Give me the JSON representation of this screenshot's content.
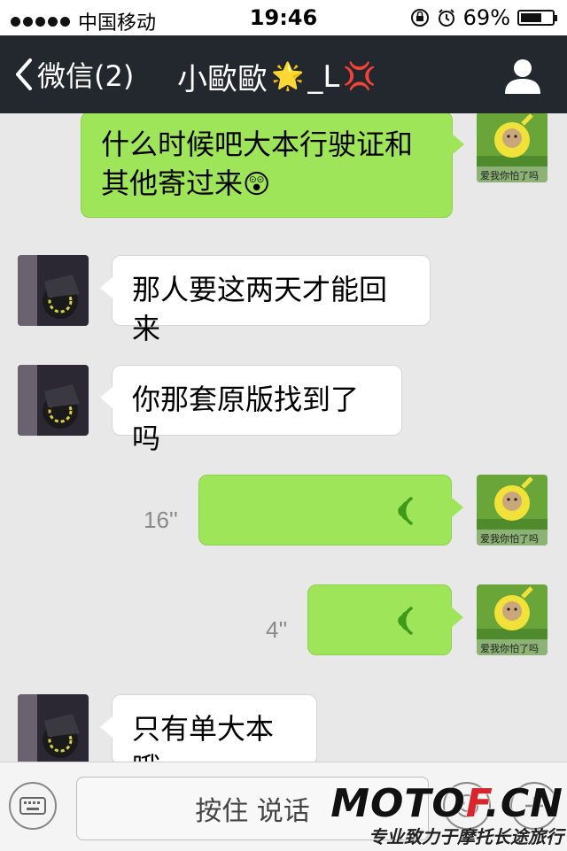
{
  "status_bar": {
    "carrier": "中国移动",
    "time": "19:46",
    "battery_text": "69%",
    "battery_level": 0.69,
    "icons": [
      "signal-dots",
      "lock-rotation-icon",
      "alarm-icon",
      "battery-icon"
    ]
  },
  "nav": {
    "back_label": "微信(2)",
    "title_prefix": "小歐歐",
    "title_suffix": "_L",
    "title_emoji_1": "🌟",
    "title_emoji_2": "💢",
    "profile_icon": "person-icon"
  },
  "messages": [
    {
      "from": "self",
      "type": "text",
      "text_line1": "什么时候吧大本行驶证和",
      "text_line2": "其他寄过来",
      "emoji": "😲"
    },
    {
      "from": "other",
      "type": "text",
      "text": "那人要这两天才能回来"
    },
    {
      "from": "other",
      "type": "text",
      "text": "你那套原版找到了吗"
    },
    {
      "from": "self",
      "type": "voice",
      "duration": "16''"
    },
    {
      "from": "self",
      "type": "voice",
      "duration": "4''"
    },
    {
      "from": "other",
      "type": "text",
      "text": "只有单大本哦"
    }
  ],
  "avatar_self_caption": "爱我你怕了吗",
  "input_bar": {
    "hold_to_talk": "按住 说话",
    "keyboard_icon": "keyboard-icon",
    "emoji_icon": "emoji-icon",
    "plus_icon": "plus-icon"
  },
  "watermark": {
    "main_left": "MOTO",
    "main_mid": "F",
    "main_right": ".CN",
    "sub": "专业致力于摩托长途旅行"
  },
  "colors": {
    "nav_bg": "#22282d",
    "self_bubble": "#9ee55a",
    "other_bubble": "#ffffff",
    "chat_bg": "#e8e8e8"
  }
}
